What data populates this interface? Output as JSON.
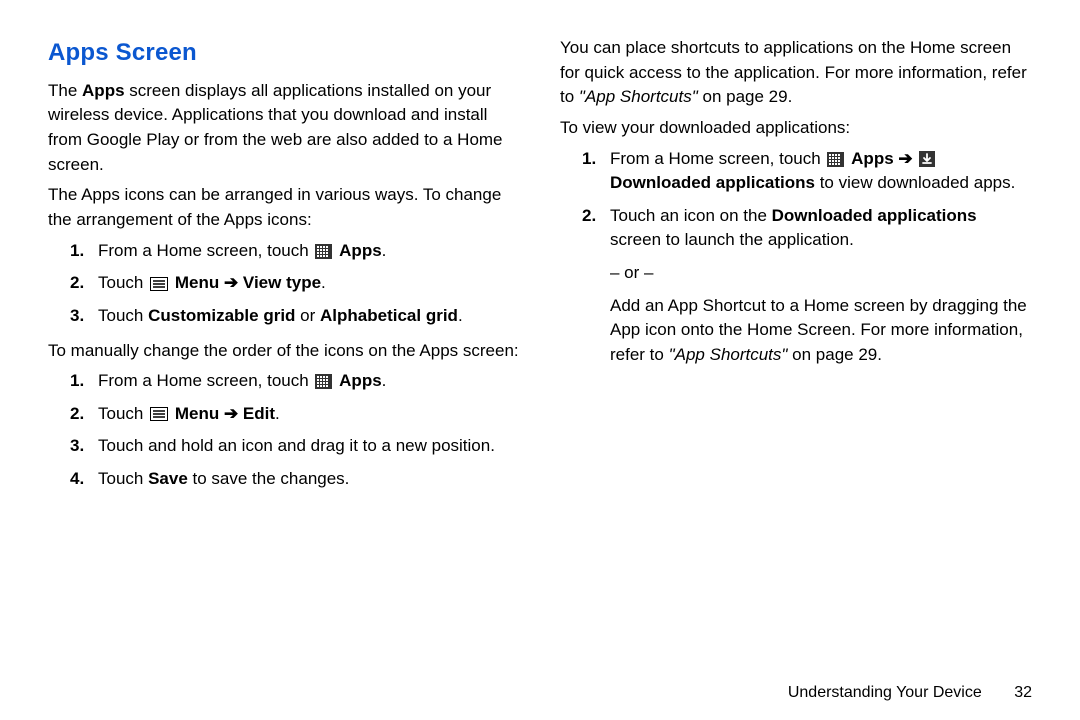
{
  "heading": "Apps Screen",
  "left": {
    "p1_a": "The ",
    "p1_b": "Apps",
    "p1_c": " screen displays all applications installed on your wireless device. Applications that you download and install from Google Play or from the web are also added to a Home screen.",
    "p2": "The Apps icons can be arranged in various ways. To change the arrangement of the Apps icons:",
    "list1": {
      "n1": "1.",
      "i1_a": "From a Home screen, touch ",
      "i1_b": "Apps",
      "i1_c": ".",
      "n2": "2.",
      "i2_a": "Touch ",
      "i2_b": "Menu",
      "i2_arrow": " ➔ ",
      "i2_c": "View type",
      "i2_d": ".",
      "n3": "3.",
      "i3_a": "Touch ",
      "i3_b": "Customizable grid",
      "i3_c": " or ",
      "i3_d": "Alphabetical grid",
      "i3_e": "."
    },
    "p3": "To manually change the order of the icons on the Apps screen:",
    "list2": {
      "n1": "1.",
      "i1_a": "From a Home screen, touch ",
      "i1_b": "Apps",
      "i1_c": ".",
      "n2": "2.",
      "i2_a": "Touch ",
      "i2_b": "Menu",
      "i2_arrow": " ➔ ",
      "i2_c": "Edit",
      "i2_d": ".",
      "n3": "3.",
      "i3": "Touch and hold an icon and drag it to a new position.",
      "n4": "4.",
      "i4_a": "Touch ",
      "i4_b": "Save",
      "i4_c": " to save the changes."
    }
  },
  "right": {
    "p1_a": "You can place shortcuts to applications on the Home screen for quick access to the application. For more information, refer to ",
    "p1_b": "\"App Shortcuts\"",
    "p1_c": " on page 29.",
    "p2": "To view your downloaded applications:",
    "list1": {
      "n1": "1.",
      "i1_a": "From a Home screen, touch ",
      "i1_b": "Apps",
      "i1_arrow": " ➔ ",
      "i1_c": "Downloaded applications",
      "i1_d": " to view downloaded apps.",
      "n2": "2.",
      "i2_a": "Touch an icon on the ",
      "i2_b": "Downloaded applications",
      "i2_c": " screen to launch the application.",
      "or": "– or –",
      "i2_d": "Add an App Shortcut to a Home screen by dragging the App icon onto the Home Screen. For more information, refer to ",
      "i2_e": "\"App Shortcuts\"",
      "i2_f": " on page 29."
    }
  },
  "footer": {
    "chapter": "Understanding Your Device",
    "page": "32"
  }
}
